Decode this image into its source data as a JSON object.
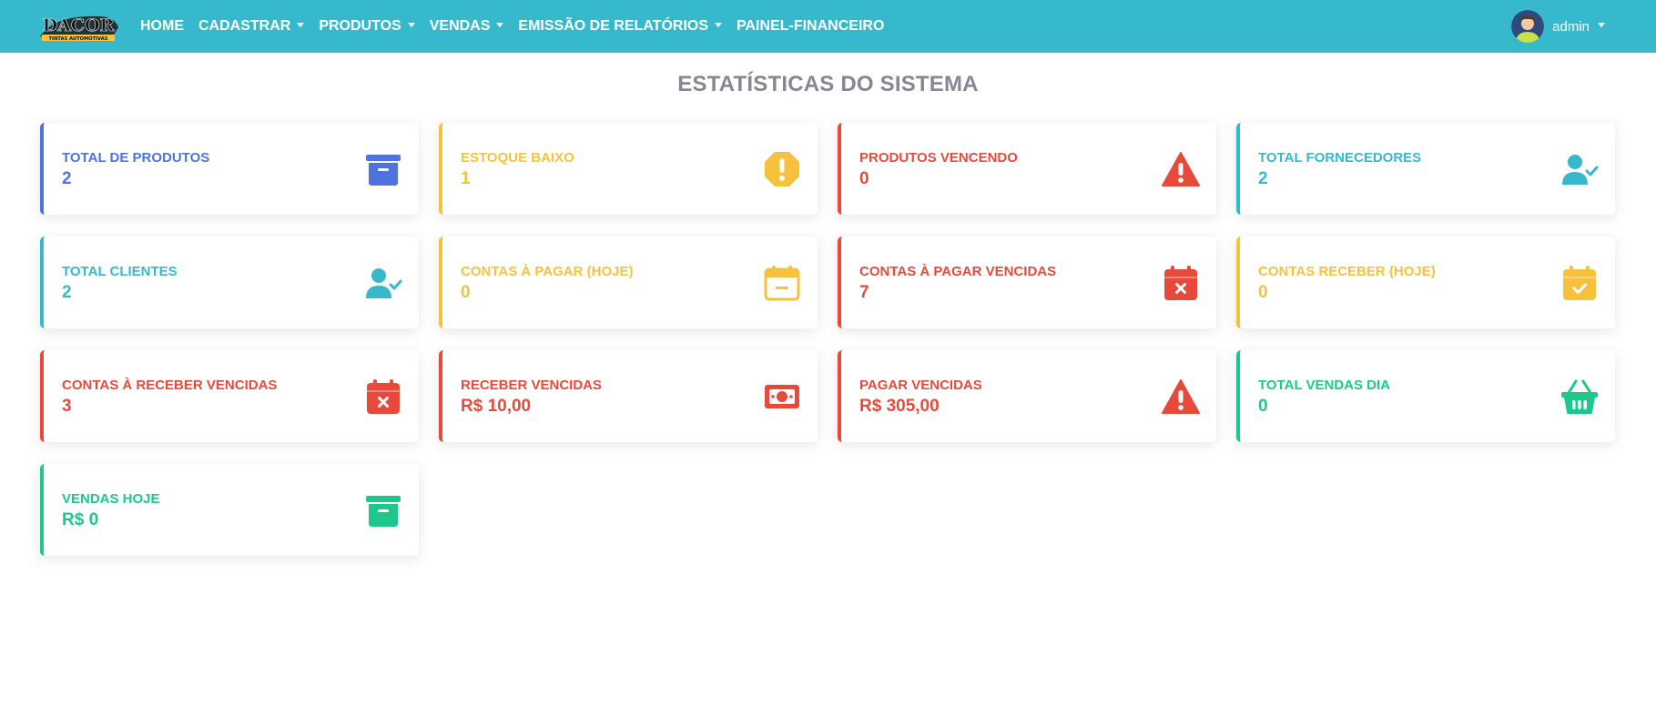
{
  "navbar": {
    "brand": {
      "main_text": "DACOR",
      "sub_text": "TINTAS AUTOMOTIVAS"
    },
    "items": [
      {
        "label": "HOME",
        "dropdown": false
      },
      {
        "label": "CADASTRAR",
        "dropdown": true
      },
      {
        "label": "PRODUTOS",
        "dropdown": true
      },
      {
        "label": "VENDAS",
        "dropdown": true
      },
      {
        "label": "EMISSÃO DE RELATÓRIOS",
        "dropdown": true
      },
      {
        "label": "PAINEL-FINANCEIRO",
        "dropdown": false
      }
    ],
    "user": {
      "name": "admin"
    }
  },
  "page": {
    "title": "ESTATÍSTICAS DO SISTEMA"
  },
  "colors": {
    "navbar": "#36b9cc",
    "primary": "#4e73df",
    "warning": "#f6c23e",
    "danger": "#e74a3b",
    "info": "#36b9cc",
    "success": "#1cc88a"
  },
  "cards": [
    {
      "label": "TOTAL DE PRODUTOS",
      "value": "2",
      "color": "#4e73df",
      "icon": "archive-icon"
    },
    {
      "label": "ESTOQUE BAIXO",
      "value": "1",
      "color": "#f6c23e",
      "icon": "exclamation-octagon-icon"
    },
    {
      "label": "PRODUTOS VENCENDO",
      "value": "0",
      "color": "#e74a3b",
      "icon": "warning-triangle-icon"
    },
    {
      "label": "TOTAL FORNECEDORES",
      "value": "2",
      "color": "#36b9cc",
      "icon": "user-check-icon"
    },
    {
      "label": "TOTAL CLIENTES",
      "value": "2",
      "color": "#36b9cc",
      "icon": "user-check-icon"
    },
    {
      "label": "CONTAS À PAGAR (HOJE)",
      "value": "0",
      "color": "#f6c23e",
      "icon": "calendar-minus-icon"
    },
    {
      "label": "CONTAS À PAGAR VENCIDAS",
      "value": "7",
      "color": "#e74a3b",
      "icon": "calendar-times-icon"
    },
    {
      "label": "CONTAS RECEBER (HOJE)",
      "value": "0",
      "color": "#f6c23e",
      "icon": "calendar-check-icon"
    },
    {
      "label": "CONTAS À RECEBER VENCIDAS",
      "value": "3",
      "color": "#e74a3b",
      "icon": "calendar-times-icon"
    },
    {
      "label": "RECEBER VENCIDAS",
      "value": "R$ 10,00",
      "color": "#e74a3b",
      "icon": "money-bill-icon"
    },
    {
      "label": "PAGAR VENCIDAS",
      "value": "R$ 305,00",
      "color": "#e74a3b",
      "icon": "warning-triangle-icon"
    },
    {
      "label": "TOTAL VENDAS DIA",
      "value": "0",
      "color": "#1cc88a",
      "icon": "shopping-basket-icon"
    },
    {
      "label": "VENDAS HOJE",
      "value": "R$ 0",
      "color": "#1cc88a",
      "icon": "archive-icon"
    }
  ]
}
